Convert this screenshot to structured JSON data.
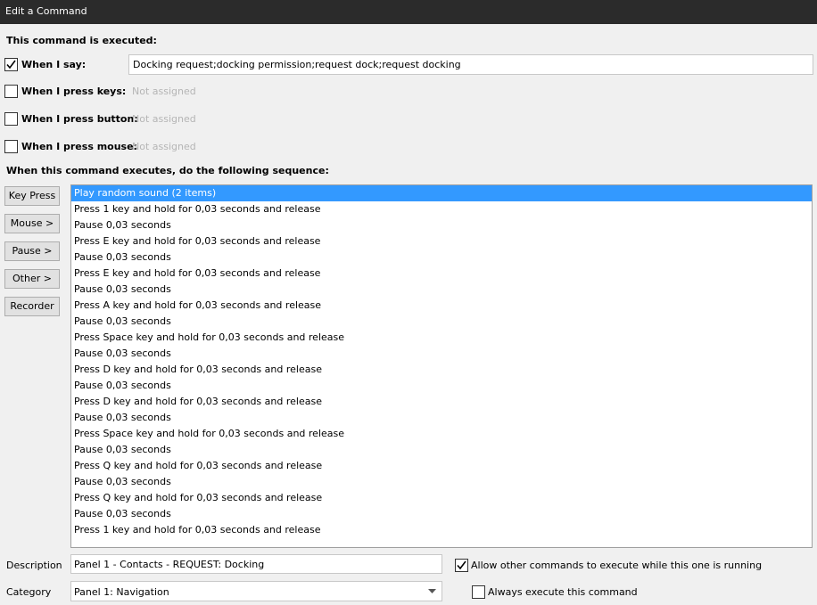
{
  "window": {
    "title": "Edit a Command"
  },
  "header": {
    "executed_label": "This command is executed:"
  },
  "triggers": {
    "say": {
      "label": "When I say:",
      "checked": true,
      "value": "Docking request;docking permission;request dock;request docking"
    },
    "keys": {
      "label": "When I press keys:",
      "checked": false,
      "value": "Not assigned"
    },
    "button": {
      "label": "When I press button:",
      "checked": false,
      "value": "Not assigned"
    },
    "mouse": {
      "label": "When I press mouse:",
      "checked": false,
      "value": "Not assigned"
    }
  },
  "sequence": {
    "label": "When this command executes, do the following sequence:",
    "selected_index": 0,
    "items": [
      "Play random sound (2 items)",
      "Press 1 key and hold for 0,03 seconds and release",
      "Pause 0,03 seconds",
      "Press E key and hold for 0,03 seconds and release",
      "Pause 0,03 seconds",
      "Press E key and hold for 0,03 seconds and release",
      "Pause 0,03 seconds",
      "Press A key and hold for 0,03 seconds and release",
      "Pause 0,03 seconds",
      "Press Space key and hold for 0,03 seconds and release",
      "Pause 0,03 seconds",
      "Press D key and hold for 0,03 seconds and release",
      "Pause 0,03 seconds",
      "Press D key and hold for 0,03 seconds and release",
      "Pause 0,03 seconds",
      "Press Space key and hold for 0,03 seconds and release",
      "Pause 0,03 seconds",
      "Press Q key and hold for 0,03 seconds and release",
      "Pause 0,03 seconds",
      "Press Q key and hold for 0,03 seconds and release",
      "Pause 0,03 seconds",
      "Press 1 key and hold for 0,03 seconds and release"
    ]
  },
  "side_buttons": {
    "key_press": "Key Press",
    "mouse": "Mouse >",
    "pause": "Pause >",
    "other": "Other >",
    "recorder": "Recorder"
  },
  "description": {
    "label": "Description",
    "value": "Panel 1 - Contacts - REQUEST: Docking"
  },
  "category": {
    "label": "Category",
    "value": "Panel 1: Navigation"
  },
  "options": {
    "allow_other": {
      "label": "Allow other commands to execute while this one is running",
      "checked": true
    },
    "always_execute": {
      "label": "Always execute this command",
      "checked": false
    }
  },
  "icons": {
    "check": "checkmark-icon",
    "dropdown": "chevron-down-icon"
  }
}
